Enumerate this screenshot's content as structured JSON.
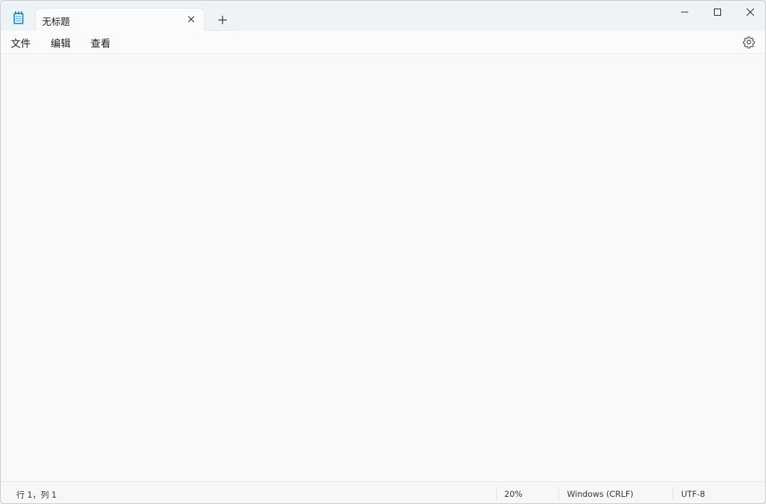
{
  "window": {
    "tab_title": "无标题"
  },
  "menu": {
    "file": "文件",
    "edit": "编辑",
    "view": "查看"
  },
  "editor": {
    "content": ""
  },
  "status": {
    "position": "行 1，列 1",
    "zoom": "20%",
    "line_ending": "Windows (CRLF)",
    "encoding": "UTF-8"
  },
  "colors": {
    "titlebar": "#eef3f8",
    "editor_bg": "#f9f9f9",
    "icon_accent": "#2aa3d6"
  }
}
